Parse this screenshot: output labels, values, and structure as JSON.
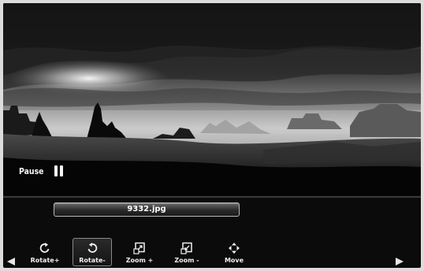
{
  "viewer": {
    "status_label": "Pause",
    "filename": "9332.jpg"
  },
  "toolbar": {
    "items": [
      {
        "label": "Rotate+",
        "icon": "rotate-clockwise-icon",
        "selected": false
      },
      {
        "label": "Rotate-",
        "icon": "rotate-counterclockwise-icon",
        "selected": true
      },
      {
        "label": "Zoom +",
        "icon": "zoom-in-icon",
        "selected": false
      },
      {
        "label": "Zoom -",
        "icon": "zoom-out-icon",
        "selected": false
      },
      {
        "label": "Move",
        "icon": "move-icon",
        "selected": false
      }
    ]
  },
  "navigation": {
    "previous_icon": "arrow-left-icon",
    "next_icon": "arrow-right-icon"
  },
  "colors": {
    "background": "#0b0b0b",
    "text": "#f2f2f2",
    "selection_border": "#8a8a8a"
  }
}
